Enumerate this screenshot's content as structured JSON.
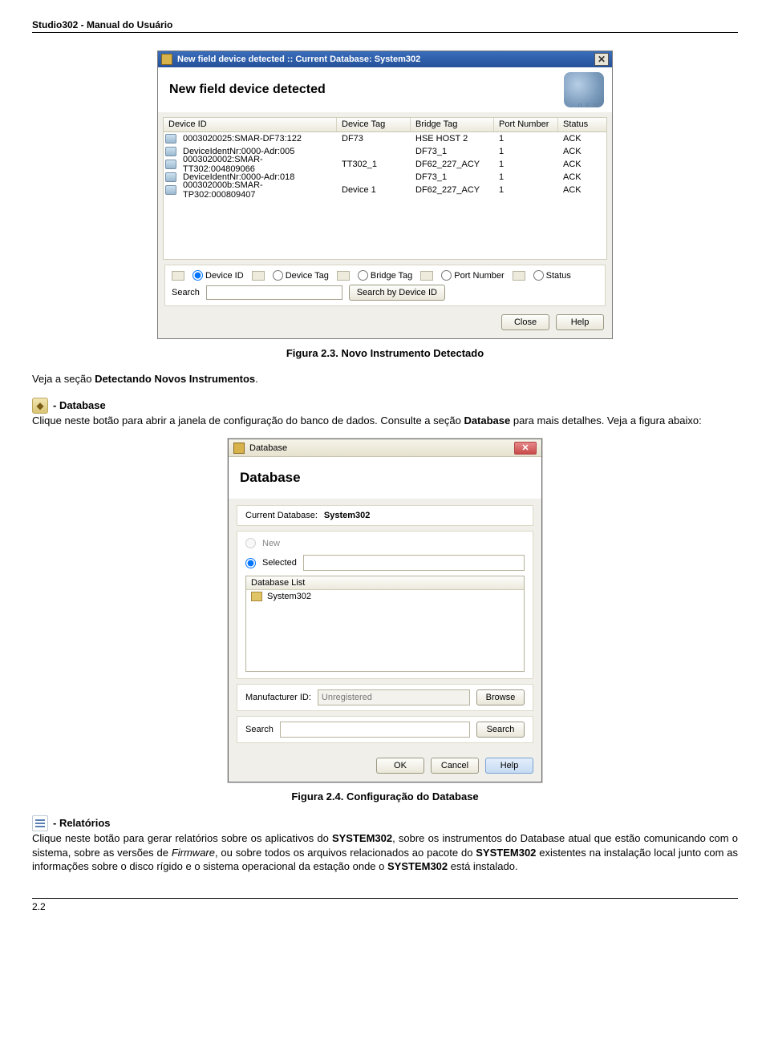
{
  "header": {
    "title": "Studio302 - Manual do Usuário"
  },
  "footer": {
    "page": "2.2"
  },
  "dialog1": {
    "titlebar": "New field device detected :: Current Database: System302",
    "banner_title": "New field device detected",
    "banner_sublabel": "n e w",
    "columns": {
      "id": "Device ID",
      "tag": "Device Tag",
      "bridge": "Bridge Tag",
      "port": "Port Number",
      "status": "Status"
    },
    "rows": [
      {
        "id": "0003020025:SMAR-DF73:122",
        "tag": "DF73",
        "bridge": "HSE HOST 2",
        "port": "1",
        "status": "ACK"
      },
      {
        "id": "DeviceIdentNr:0000-Adr:005",
        "tag": "",
        "bridge": "DF73_1",
        "port": "1",
        "status": "ACK"
      },
      {
        "id": "0003020002:SMAR-TT302:004809066",
        "tag": "TT302_1",
        "bridge": "DF62_227_ACY",
        "port": "1",
        "status": "ACK"
      },
      {
        "id": "DeviceIdentNr:0000-Adr:018",
        "tag": "",
        "bridge": "DF73_1",
        "port": "1",
        "status": "ACK"
      },
      {
        "id": "000302000b:SMAR-TP302:000809407",
        "tag": "Device 1",
        "bridge": "DF62_227_ACY",
        "port": "1",
        "status": "ACK"
      }
    ],
    "filter": {
      "opt_id": "Device ID",
      "opt_tag": "Device Tag",
      "opt_bridge": "Bridge Tag",
      "opt_port": "Port Number",
      "opt_status": "Status",
      "search_label": "Search",
      "search_btn": "Search by Device ID"
    },
    "buttons": {
      "close": "Close",
      "help": "Help"
    }
  },
  "caption1": "Figura 2.3. Novo Instrumento Detectado",
  "para_veja_a": "Veja a seção ",
  "para_veja_b_bold": "Detectando Novos Instrumentos",
  "para_veja_c": ".",
  "section_db": {
    "title": " - Database",
    "text_a": "Clique neste botão para abrir a janela de configuração do banco de dados. Consulte a seção ",
    "text_b_bold": "Database",
    "text_c": " para mais detalhes. Veja a figura abaixo:"
  },
  "dialog2": {
    "titlebar": "Database",
    "banner_title": "Database",
    "current_db_label": "Current Database:",
    "current_db_value": "System302",
    "opt_new": "New",
    "opt_selected": "Selected",
    "list_header": "Database List",
    "list_item": "System302",
    "manuf_label": "Manufacturer ID:",
    "manuf_value": "Unregistered",
    "browse_btn": "Browse",
    "search_label": "Search",
    "search_btn": "Search",
    "buttons": {
      "ok": "OK",
      "cancel": "Cancel",
      "help": "Help"
    }
  },
  "caption2": "Figura 2.4. Configuração do Database",
  "section_report": {
    "title": " - Relatórios",
    "text_a": "Clique neste botão para gerar relatórios sobre os aplicativos do ",
    "b1": "SYSTEM302",
    "text_b": ", sobre os instrumentos do Database atual que estão comunicando com o sistema, sobre as versões de ",
    "i1": "Firmware",
    "text_c": ", ou sobre todos os arquivos relacionados ao pacote do ",
    "b2": "SYSTEM302",
    "text_d": " existentes na instalação local junto com as informações sobre o disco rígido e o sistema operacional da estação onde o ",
    "b3": "SYSTEM302",
    "text_e": " está instalado."
  }
}
